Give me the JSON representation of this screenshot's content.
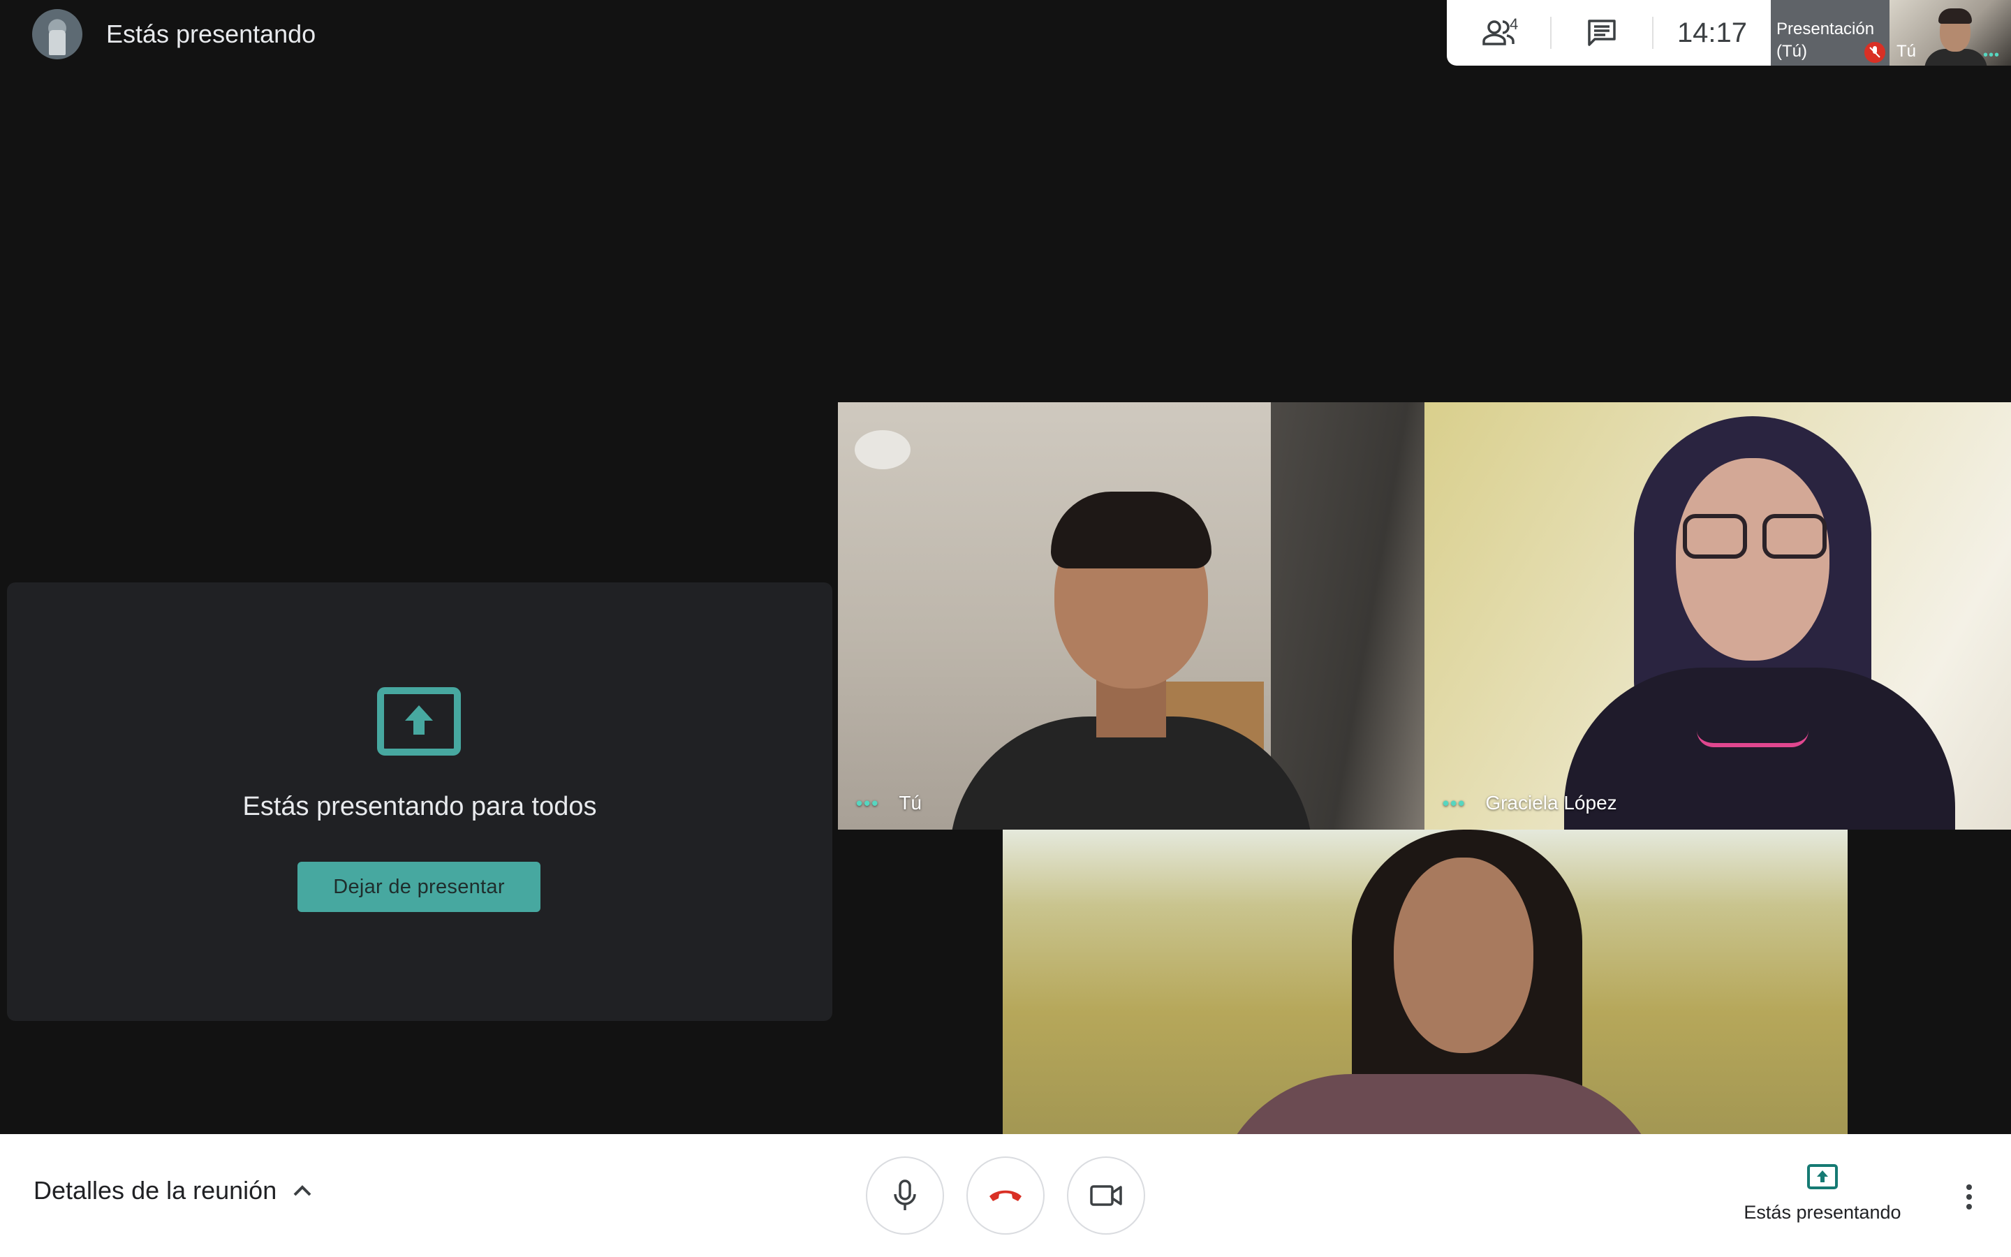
{
  "top_bar": {
    "presenting_label": "Estás presentando"
  },
  "info_panel": {
    "people_count": "4",
    "time": "14:17",
    "presentation_tile_label": "Presentación (Tú)",
    "self_tile_label": "Tú"
  },
  "present_card": {
    "message": "Estás presentando para todos",
    "stop_button_label": "Dejar de presentar"
  },
  "participants": [
    {
      "name": "Tú"
    },
    {
      "name": "Graciela López"
    },
    {
      "name": ""
    }
  ],
  "bottom_bar": {
    "details_label": "Detalles de la reunión",
    "presenting_label": "Estás presentando"
  },
  "colors": {
    "accent_teal": "#47a8a0",
    "hangup_red": "#d93025",
    "background": "#121212",
    "card_background": "#202124"
  },
  "icons": {
    "people": "people-icon",
    "chat": "chat-icon",
    "mic": "mic-icon",
    "hangup": "phone-hangup-icon",
    "camera": "camera-icon",
    "present": "present-screen-icon",
    "more": "more-vert-icon",
    "chevron": "chevron-up-icon",
    "mute": "mic-off-icon"
  }
}
